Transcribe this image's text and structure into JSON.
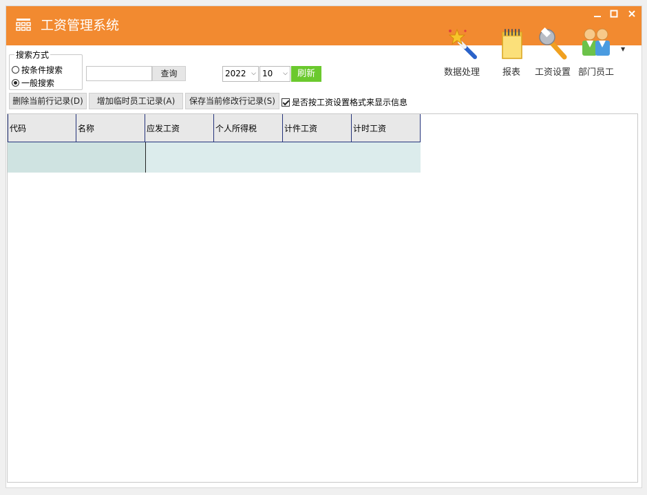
{
  "window": {
    "title": "工资管理系统",
    "accent": "#f28a30"
  },
  "window_controls": [
    "minimize-button",
    "maximize-button",
    "close-button"
  ],
  "toolbar": {
    "items": [
      {
        "label": "数据处理",
        "icon": "magic-wand-icon"
      },
      {
        "label": "报表",
        "icon": "notepad-icon"
      },
      {
        "label": "工资设置",
        "icon": "wrench-icon"
      },
      {
        "label": "部门员工",
        "icon": "users-icon"
      }
    ]
  },
  "search_mode": {
    "legend": "搜索方式",
    "options": [
      {
        "label": "按条件搜索",
        "selected": false
      },
      {
        "label": "一般搜索",
        "selected": true
      }
    ]
  },
  "search": {
    "value": "",
    "query_label": "查询"
  },
  "period": {
    "year": "2022",
    "month": "10",
    "refresh_label": "刷新",
    "refresh_color": "#6bc92e"
  },
  "actions": {
    "delete_label": "删除当前行记录(D)",
    "add_temp_label": "增加临时员工记录(A)",
    "save_label": "保存当前修改行记录(S)",
    "format_checkbox_label": "是否按工资设置格式来显示信息",
    "format_checked": true
  },
  "table": {
    "columns": [
      "代码",
      "名称",
      "应发工资",
      "个人所得税",
      "计件工资",
      "计时工资"
    ],
    "rows": [
      [
        "",
        "",
        "",
        "",
        "",
        ""
      ]
    ]
  }
}
